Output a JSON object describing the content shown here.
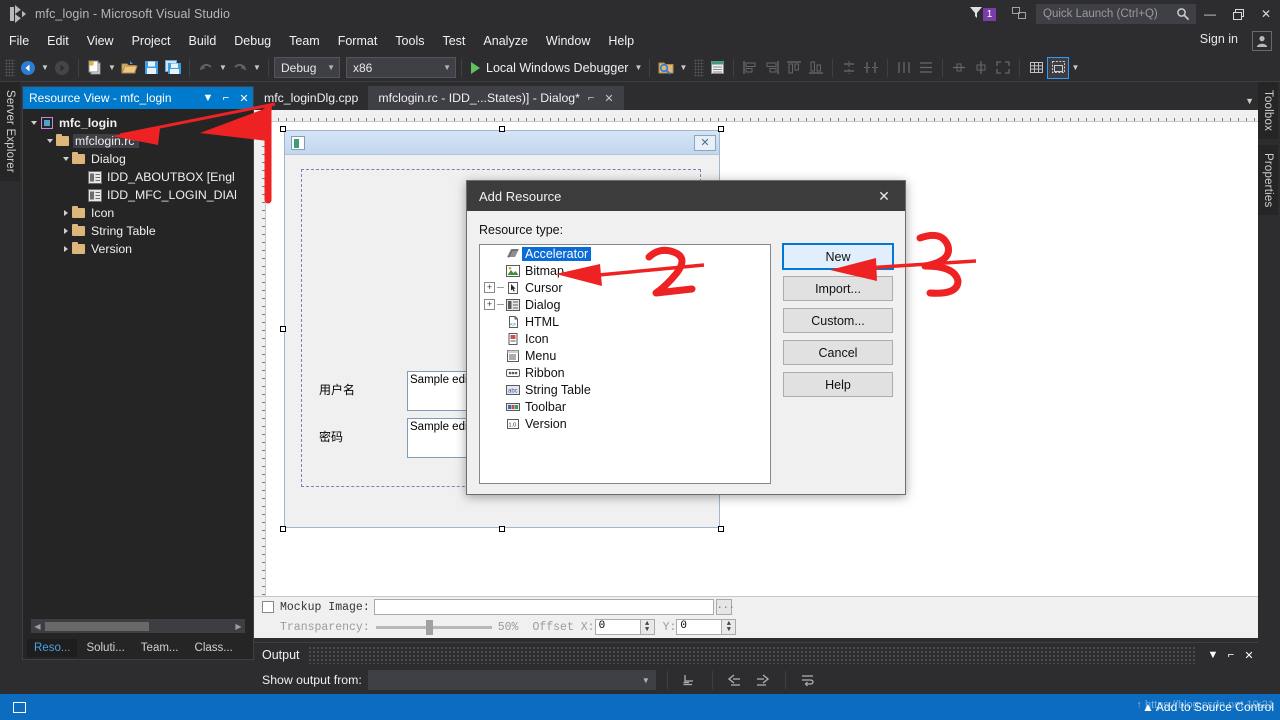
{
  "window": {
    "title": "mfc_login - Microsoft Visual Studio",
    "logo_icon": "visual-studio-logo-icon",
    "minimize_label": "—",
    "maximize_label": "❐",
    "close_label": "✕"
  },
  "titlebar": {
    "notification_icon": "funnel-notification-icon",
    "notification_count": "1",
    "feedback_icon": "send-feedback-icon",
    "quick_launch_placeholder": "Quick Launch (Ctrl+Q)",
    "quick_launch_value": "",
    "search_icon": "search-icon"
  },
  "menubar": {
    "items": [
      {
        "label": "File"
      },
      {
        "label": "Edit"
      },
      {
        "label": "View"
      },
      {
        "label": "Project"
      },
      {
        "label": "Build"
      },
      {
        "label": "Debug"
      },
      {
        "label": "Team"
      },
      {
        "label": "Format"
      },
      {
        "label": "Tools"
      },
      {
        "label": "Test"
      },
      {
        "label": "Analyze"
      },
      {
        "label": "Window"
      },
      {
        "label": "Help"
      }
    ],
    "sign_in": "Sign in",
    "account_icon": "account-person-icon"
  },
  "toolbar": {
    "navigate_back_icon": "navigate-back-icon",
    "navigate_forward_icon": "navigate-forward-icon",
    "new_project_icon": "new-project-icon",
    "open_file_icon": "open-file-icon",
    "save_icon": "save-icon",
    "save_all_icon": "save-all-icon",
    "undo_icon": "undo-icon",
    "redo_icon": "redo-icon",
    "configuration": "Debug",
    "platform": "x86",
    "run_label": "Local Windows Debugger",
    "run_icon": "play-triangle-icon",
    "find_icon": "find-in-files-icon",
    "properties_window_icon": "properties-window-icon",
    "align_lefts_icon": "align-lefts-icon",
    "align_rights_icon": "align-rights-icon",
    "align_tops_icon": "align-tops-icon",
    "align_bottoms_icon": "align-bottoms-icon",
    "make_same_width_icon": "make-same-width-icon",
    "make_same_height_icon": "make-same-height-icon",
    "space_across_icon": "space-across-icon",
    "space_down_icon": "space-down-icon",
    "center_horizontally_icon": "center-horizontally-icon",
    "center_vertically_icon": "center-vertically-icon",
    "toggle_guides_icon": "toggle-guides-icon",
    "tab_order_icon": "tab-order-icon",
    "test_dialog_icon": "test-dialog-icon"
  },
  "dock_left": {
    "server_explorer": "Server Explorer"
  },
  "dock_right": {
    "toolbox": "Toolbox",
    "properties": "Properties"
  },
  "resource_view": {
    "title": "Resource View - mfc_login",
    "dropdown_icon": "chevron-down-icon",
    "pin_icon": "pin-icon",
    "close_icon": "close-icon",
    "tree": [
      {
        "label": "mfc_login",
        "indent": 0,
        "expander": "open",
        "icon": "project-icon",
        "bold": true,
        "highlight": false
      },
      {
        "label": "mfclogin.rc*",
        "indent": 1,
        "expander": "open",
        "icon": "folder-icon",
        "bold": false,
        "highlight": true
      },
      {
        "label": "Dialog",
        "indent": 2,
        "expander": "open",
        "icon": "folder-icon",
        "bold": false,
        "highlight": false
      },
      {
        "label": "IDD_ABOUTBOX [Engl",
        "indent": 3,
        "expander": "none",
        "icon": "dialog-resource-icon",
        "bold": false,
        "highlight": false
      },
      {
        "label": "IDD_MFC_LOGIN_DIAl",
        "indent": 3,
        "expander": "none",
        "icon": "dialog-resource-icon",
        "bold": false,
        "highlight": false
      },
      {
        "label": "Icon",
        "indent": 2,
        "expander": "closed",
        "icon": "folder-icon",
        "bold": false,
        "highlight": false
      },
      {
        "label": "String Table",
        "indent": 2,
        "expander": "closed",
        "icon": "folder-icon",
        "bold": false,
        "highlight": false
      },
      {
        "label": "Version",
        "indent": 2,
        "expander": "closed",
        "icon": "folder-icon",
        "bold": false,
        "highlight": false
      }
    ],
    "scroll_left_icon": "scroll-left-icon",
    "scroll_right_icon": "scroll-right-icon",
    "bottom_tabs": [
      {
        "label": "Reso...",
        "active": true
      },
      {
        "label": "Soluti...",
        "active": false
      },
      {
        "label": "Team...",
        "active": false
      },
      {
        "label": "Class...",
        "active": false
      }
    ]
  },
  "document_tabs": [
    {
      "label": "mfc_loginDlg.cpp",
      "active": false
    },
    {
      "label": "mfclogin.rc - IDD_...States)] - Dialog*",
      "active": true,
      "pin_icon": "pin-icon",
      "close_icon": "close-icon"
    }
  ],
  "tabstrip_overflow_icon": "chevron-down-icon",
  "designer": {
    "dialog_app_icon": "app-icon",
    "dialog_close_label": "✕",
    "controls": [
      {
        "name": "username-label",
        "text": "用户名"
      },
      {
        "name": "username-edit",
        "text": "Sample edit"
      },
      {
        "name": "password-label",
        "text": "密码"
      },
      {
        "name": "password-edit",
        "text": "Sample edit"
      }
    ]
  },
  "mockup_bar": {
    "checkbox_label": "Mockup Image:",
    "checked": false,
    "path_value": "",
    "browse_label": "...",
    "transparency_label": "Transparency:",
    "transparency_value": "50%",
    "offset_x_label": "Offset X:",
    "offset_x_value": "0",
    "offset_y_label": "Y:",
    "offset_y_value": "0"
  },
  "output_panel": {
    "title": "Output",
    "show_output_from_label": "Show output from:",
    "source_value": "",
    "dropdown_icon": "chevron-down-icon",
    "clear_all_icon": "clear-all-icon",
    "go_to_previous_icon": "go-to-previous-message-icon",
    "go_to_next_icon": "go-to-next-message-icon",
    "toggle_word_wrap_icon": "toggle-word-wrap-icon",
    "autoscroll_icon": "autoscroll-icon",
    "dropdown_panel_icon": "chevron-down-icon",
    "pin_icon": "pin-icon",
    "close_icon": "close-icon"
  },
  "add_resource_dialog": {
    "title": "Add Resource",
    "close_icon": "close-icon",
    "resource_type_label": "Resource type:",
    "resource_types": [
      {
        "label": "Accelerator",
        "icon": "accelerator-icon",
        "expandable": false,
        "selected": true
      },
      {
        "label": "Bitmap",
        "icon": "bitmap-icon",
        "expandable": false,
        "selected": false
      },
      {
        "label": "Cursor",
        "icon": "cursor-icon",
        "expandable": true,
        "selected": false
      },
      {
        "label": "Dialog",
        "icon": "dialog-icon",
        "expandable": true,
        "selected": false
      },
      {
        "label": "HTML",
        "icon": "html-icon",
        "expandable": false,
        "selected": false
      },
      {
        "label": "Icon",
        "icon": "icon-file-icon",
        "expandable": false,
        "selected": false
      },
      {
        "label": "Menu",
        "icon": "menu-icon",
        "expandable": false,
        "selected": false
      },
      {
        "label": "Ribbon",
        "icon": "ribbon-icon",
        "expandable": false,
        "selected": false
      },
      {
        "label": "String Table",
        "icon": "string-table-icon",
        "expandable": false,
        "selected": false
      },
      {
        "label": "Toolbar",
        "icon": "toolbar-icon",
        "expandable": false,
        "selected": false
      },
      {
        "label": "Version",
        "icon": "version-icon",
        "expandable": false,
        "selected": false
      }
    ],
    "buttons": [
      {
        "label": "New",
        "default": true
      },
      {
        "label": "Import...",
        "default": false
      },
      {
        "label": "Custom...",
        "default": false
      },
      {
        "label": "Cancel",
        "default": false
      },
      {
        "label": "Help",
        "default": false
      }
    ]
  },
  "annotations": {
    "color": "#ee2222",
    "marks": [
      {
        "name": "arrow-to-mfclogin-rc",
        "type": "arrow"
      },
      {
        "name": "digit-2-near-bitmap",
        "type": "digit",
        "text": "2"
      },
      {
        "name": "arrow-to-bitmap",
        "type": "arrow"
      },
      {
        "name": "digit-3-near-import",
        "type": "digit",
        "text": "3"
      },
      {
        "name": "arrow-to-import-button",
        "type": "arrow"
      }
    ]
  },
  "taskbar": {
    "background": "#0b6cc0",
    "start_icon": "windows-start-icon",
    "status_text": "Add to Source Control",
    "watermark_text": "↑ https://blog.csdn.net  19:21"
  }
}
